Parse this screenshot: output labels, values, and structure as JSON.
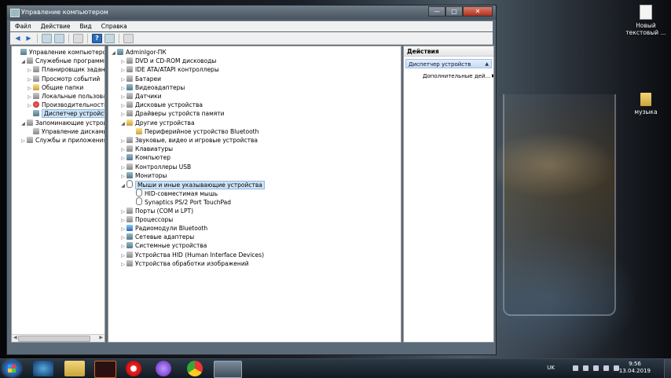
{
  "window": {
    "title": "Управление компьютером",
    "buttons": {
      "minimize": "—",
      "maximize": "□",
      "close": "✕"
    }
  },
  "menu": [
    "Файл",
    "Действие",
    "Вид",
    "Справка"
  ],
  "left_tree": [
    {
      "label": "Управление компьютером (л",
      "indent": 0,
      "exp": "",
      "icon": "comp"
    },
    {
      "label": "Служебные программы",
      "indent": 1,
      "exp": "◢",
      "icon": "tool"
    },
    {
      "label": "Планировщик заданий",
      "indent": 2,
      "exp": "▷",
      "icon": "tool"
    },
    {
      "label": "Просмотр событий",
      "indent": 2,
      "exp": "▷",
      "icon": "tool"
    },
    {
      "label": "Общие папки",
      "indent": 2,
      "exp": "▷",
      "icon": "yel"
    },
    {
      "label": "Локальные пользовате",
      "indent": 2,
      "exp": "▷",
      "icon": "tool"
    },
    {
      "label": "Производительность",
      "indent": 2,
      "exp": "▷",
      "icon": "red"
    },
    {
      "label": "Диспетчер устройств",
      "indent": 2,
      "exp": "",
      "icon": "comp",
      "selected": true
    },
    {
      "label": "Запоминающие устройст",
      "indent": 1,
      "exp": "◢",
      "icon": "tool"
    },
    {
      "label": "Управление дисками",
      "indent": 2,
      "exp": "",
      "icon": "tool"
    },
    {
      "label": "Службы и приложения",
      "indent": 1,
      "exp": "▷",
      "icon": "tool"
    }
  ],
  "device_tree": [
    {
      "label": "AdminIgor-ПК",
      "indent": 0,
      "exp": "◢",
      "icon": "comp"
    },
    {
      "label": "DVD и CD-ROM дисководы",
      "indent": 1,
      "exp": "▷",
      "icon": "tool"
    },
    {
      "label": "IDE ATA/ATAPI контроллеры",
      "indent": 1,
      "exp": "▷",
      "icon": "tool"
    },
    {
      "label": "Батареи",
      "indent": 1,
      "exp": "▷",
      "icon": "tool"
    },
    {
      "label": "Видеоадаптеры",
      "indent": 1,
      "exp": "▷",
      "icon": "comp"
    },
    {
      "label": "Датчики",
      "indent": 1,
      "exp": "▷",
      "icon": "tool"
    },
    {
      "label": "Дисковые устройства",
      "indent": 1,
      "exp": "▷",
      "icon": "tool"
    },
    {
      "label": "Драйверы устройств памяти",
      "indent": 1,
      "exp": "▷",
      "icon": "tool"
    },
    {
      "label": "Другие устройства",
      "indent": 1,
      "exp": "◢",
      "icon": "yel"
    },
    {
      "label": "Периферийное устройство Bluetooth",
      "indent": 2,
      "exp": "",
      "icon": "yel"
    },
    {
      "label": "Звуковые, видео и игровые устройства",
      "indent": 1,
      "exp": "▷",
      "icon": "tool"
    },
    {
      "label": "Клавиатуры",
      "indent": 1,
      "exp": "▷",
      "icon": "tool"
    },
    {
      "label": "Компьютер",
      "indent": 1,
      "exp": "▷",
      "icon": "comp"
    },
    {
      "label": "Контроллеры USB",
      "indent": 1,
      "exp": "▷",
      "icon": "tool"
    },
    {
      "label": "Мониторы",
      "indent": 1,
      "exp": "▷",
      "icon": "comp"
    },
    {
      "label": "Мыши и иные указывающие устройства",
      "indent": 1,
      "exp": "◢",
      "icon": "mouse",
      "selected": true
    },
    {
      "label": "HID-совместимая мышь",
      "indent": 2,
      "exp": "",
      "icon": "mouse"
    },
    {
      "label": "Synaptics PS/2 Port TouchPad",
      "indent": 2,
      "exp": "",
      "icon": "mouse"
    },
    {
      "label": "Порты (COM и LPT)",
      "indent": 1,
      "exp": "▷",
      "icon": "tool"
    },
    {
      "label": "Процессоры",
      "indent": 1,
      "exp": "▷",
      "icon": "tool"
    },
    {
      "label": "Радиомодули Bluetooth",
      "indent": 1,
      "exp": "▷",
      "icon": "blue"
    },
    {
      "label": "Сетевые адаптеры",
      "indent": 1,
      "exp": "▷",
      "icon": "comp"
    },
    {
      "label": "Системные устройства",
      "indent": 1,
      "exp": "▷",
      "icon": "comp"
    },
    {
      "label": "Устройства HID (Human Interface Devices)",
      "indent": 1,
      "exp": "▷",
      "icon": "tool"
    },
    {
      "label": "Устройства обработки изображений",
      "indent": 1,
      "exp": "▷",
      "icon": "tool"
    }
  ],
  "actions": {
    "header": "Действия",
    "section": "Диспетчер устройств",
    "item": "Дополнительные дей..."
  },
  "desktop": {
    "file_icon_label_1": "Новый",
    "file_icon_label_2": "текстовый ...",
    "folder_icon_label": "музыка"
  },
  "taskbar": {
    "language": "UK",
    "time": "9:56",
    "date": "13.04.2019"
  }
}
